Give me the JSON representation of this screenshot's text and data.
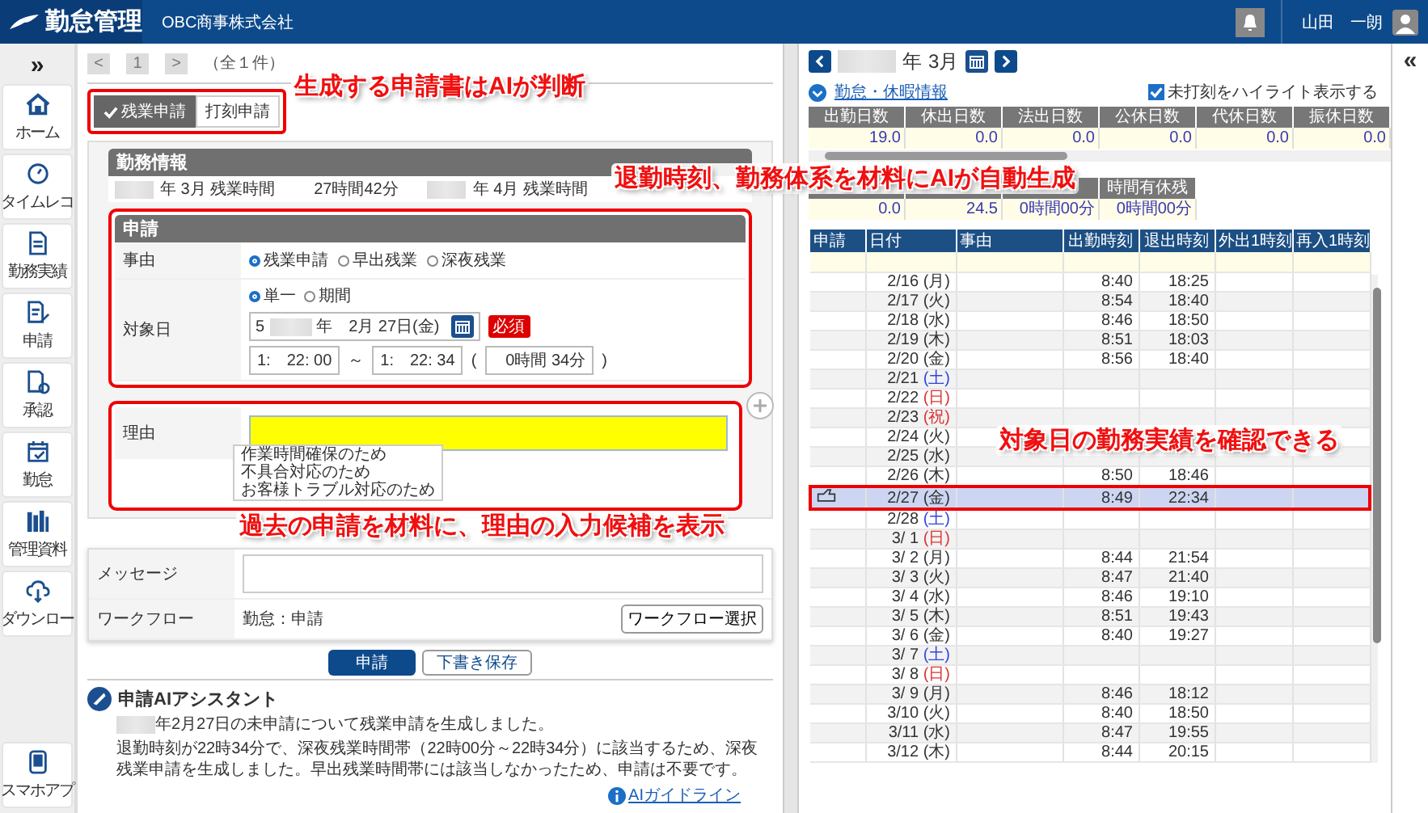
{
  "header": {
    "logo": "勤怠管理",
    "company": "OBC商事株式会社",
    "user": "山田　一朗"
  },
  "sidebar": {
    "toggle": "»",
    "items": [
      {
        "label": "ホーム"
      },
      {
        "label": "タイムレコ"
      },
      {
        "label": "勤務実績"
      },
      {
        "label": "申請"
      },
      {
        "label": "承認"
      },
      {
        "label": "勤怠"
      },
      {
        "label": "管理資料"
      },
      {
        "label": "ダウンロー"
      }
    ],
    "bottom_item": {
      "label": "スマホアプ"
    }
  },
  "pager": {
    "prev": "<",
    "page": "1",
    "next": ">",
    "total": "（全１件）"
  },
  "request_tabs": [
    {
      "label": "残業申請",
      "selected": true
    },
    {
      "label": "打刻申請",
      "selected": false
    }
  ],
  "work_info": {
    "title": "勤務情報",
    "items": [
      {
        "label": "年 3月 残業時間",
        "value": "27時間42分"
      },
      {
        "label": "年 4月 残業時間"
      }
    ]
  },
  "application": {
    "title": "申請",
    "reason_label": "事由",
    "reasons": [
      {
        "label": "残業申請",
        "selected": true
      },
      {
        "label": "早出残業",
        "selected": false
      },
      {
        "label": "深夜残業",
        "selected": false
      }
    ],
    "date_label": "対象日",
    "date_modes": [
      {
        "label": "単一",
        "selected": true
      },
      {
        "label": "期間",
        "selected": false
      }
    ],
    "date_prefix": "5",
    "date_value": "年　2月 27日(金)",
    "required": "必須",
    "start_time": "1:　22: 00",
    "tilde": "～",
    "end_time": "1:　22: 34",
    "paren_open": "(",
    "duration": "0時間 34分",
    "paren_close": ")"
  },
  "reason_field": {
    "label": "理由",
    "suggestions": [
      "作業時間確保のため",
      "不具合対応のため",
      "お客様トラブル対応のため"
    ]
  },
  "message": {
    "label": "メッセージ"
  },
  "workflow": {
    "label": "ワークフロー",
    "value": "勤怠：申請",
    "button": "ワークフロー選択"
  },
  "actions": {
    "submit": "申請",
    "draft": "下書き保存"
  },
  "assistant": {
    "title": "申請AIアシスタント",
    "lines": [
      "年2月27日の未申請について残業申請を生成しました。",
      "退勤時刻が22時34分で、深夜残業時間帯（22時00分～22時34分）に該当するため、深夜残業申請を生成しました。早出残業時間帯には該当しなかったため、申請は不要です。"
    ],
    "link": "AIガイドライン"
  },
  "month_nav": {
    "year_suffix": "年",
    "month": "3月"
  },
  "summary": {
    "link": "勤怠・休暇情報",
    "highlight": {
      "label": "未打刻をハイライト表示する",
      "checked": true
    },
    "columns": [
      "出勤日数",
      "休出日数",
      "法出日数",
      "公休日数",
      "代休日数",
      "振休日数"
    ],
    "values": [
      "19.0",
      "0.0",
      "0.0",
      "0.0",
      "0.0",
      "0.0"
    ],
    "column_4_2": "時間有休残",
    "values_2": [
      "0.0",
      "24.5",
      "0時間00分",
      "0時間00分"
    ]
  },
  "table": {
    "columns": [
      "申請",
      "日付",
      "事由",
      "出勤時刻",
      "退出時刻",
      "外出1時刻",
      "再入1時刻"
    ],
    "rows": [
      {
        "date": "2/16",
        "day": "(月)",
        "color": "#333333",
        "in": "8:40",
        "out": "18:25",
        "selected": false
      },
      {
        "date": "2/17",
        "day": "(火)",
        "color": "#333333",
        "in": "8:54",
        "out": "18:40",
        "selected": false
      },
      {
        "date": "2/18",
        "day": "(水)",
        "color": "#333333",
        "in": "8:46",
        "out": "18:50",
        "selected": false
      },
      {
        "date": "2/19",
        "day": "(木)",
        "color": "#333333",
        "in": "8:51",
        "out": "18:03",
        "selected": false
      },
      {
        "date": "2/20",
        "day": "(金)",
        "color": "#333333",
        "in": "8:56",
        "out": "18:40",
        "selected": false
      },
      {
        "date": "2/21",
        "day": "(土)",
        "color": "#3344dd",
        "selected": false
      },
      {
        "date": "2/22",
        "day": "(日)",
        "color": "#dd3333",
        "selected": false
      },
      {
        "date": "2/23",
        "day": "(祝)",
        "color": "#dd3333",
        "selected": false
      },
      {
        "date": "2/24",
        "day": "(火)",
        "color": "#333333",
        "selected": false
      },
      {
        "date": "2/25",
        "day": "(水)",
        "color": "#333333",
        "selected": false
      },
      {
        "date": "2/26",
        "day": "(木)",
        "color": "#333333",
        "in": "8:50",
        "out": "18:46",
        "selected": false
      },
      {
        "date": "2/27",
        "day": "(金)",
        "color": "#333333",
        "in": "8:49",
        "out": "22:34",
        "selected": true
      },
      {
        "date": "2/28",
        "day": "(土)",
        "color": "#3344dd",
        "selected": false
      },
      {
        "date": "3/ 1",
        "day": "(日)",
        "color": "#dd3333",
        "selected": false
      },
      {
        "date": "3/ 2",
        "day": "(月)",
        "color": "#333333",
        "in": "8:44",
        "out": "21:54",
        "selected": false
      },
      {
        "date": "3/ 3",
        "day": "(火)",
        "color": "#333333",
        "in": "8:47",
        "out": "21:40",
        "selected": false
      },
      {
        "date": "3/ 4",
        "day": "(水)",
        "color": "#333333",
        "in": "8:46",
        "out": "19:10",
        "selected": false
      },
      {
        "date": "3/ 5",
        "day": "(木)",
        "color": "#333333",
        "in": "8:51",
        "out": "19:43",
        "selected": false
      },
      {
        "date": "3/ 6",
        "day": "(金)",
        "color": "#333333",
        "in": "8:40",
        "out": "19:27",
        "selected": false
      },
      {
        "date": "3/ 7",
        "day": "(土)",
        "color": "#3344dd",
        "selected": false
      },
      {
        "date": "3/ 8",
        "day": "(日)",
        "color": "#dd3333",
        "selected": false
      },
      {
        "date": "3/ 9",
        "day": "(月)",
        "color": "#333333",
        "in": "8:46",
        "out": "18:12",
        "selected": false
      },
      {
        "date": "3/10",
        "day": "(火)",
        "color": "#333333",
        "in": "8:40",
        "out": "18:50",
        "selected": false
      },
      {
        "date": "3/11",
        "day": "(水)",
        "color": "#333333",
        "in": "8:47",
        "out": "19:55",
        "selected": false
      },
      {
        "date": "3/12",
        "day": "(木)",
        "color": "#333333",
        "in": "8:44",
        "out": "20:15",
        "selected": false
      }
    ]
  },
  "right_panel": {
    "collapse": "«"
  },
  "callouts": [
    "生成する申請書はAIが判断",
    "退勤時刻、勤務体系を材料にAIが自動生成",
    "対象日の勤務実績を確認できる",
    "過去の申請を材料に、理由の入力候補を表示"
  ]
}
